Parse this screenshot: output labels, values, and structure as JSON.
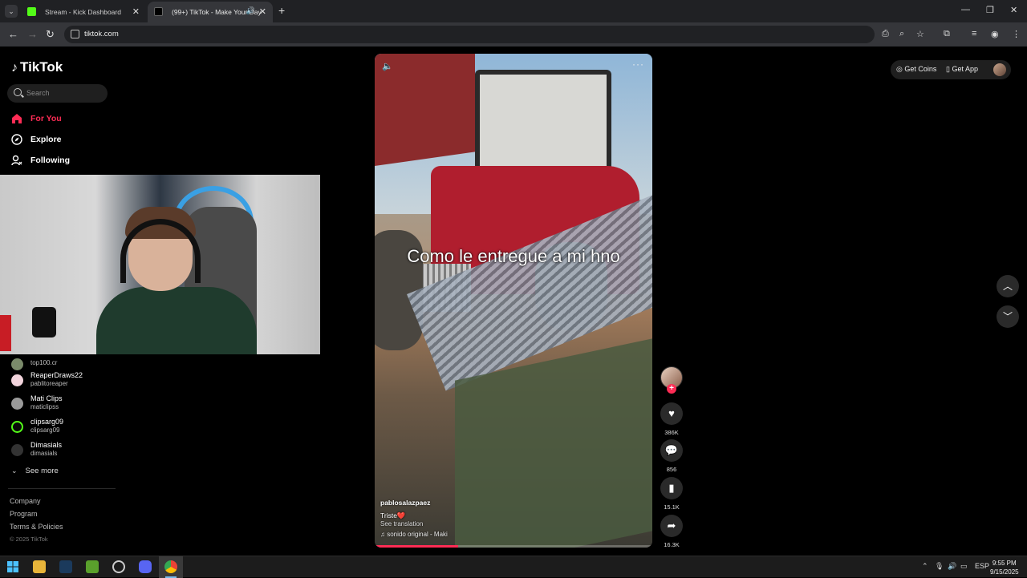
{
  "browser": {
    "tabs": [
      {
        "title": "Stream - Kick Dashboard"
      },
      {
        "title": "(99+) TikTok - Make Your Day"
      }
    ],
    "new_tab_label": "+",
    "url": "tiktok.com"
  },
  "tiktok": {
    "logo": "TikTok",
    "search_placeholder": "Search",
    "nav": [
      {
        "label": "For You"
      },
      {
        "label": "Explore"
      },
      {
        "label": "Following"
      }
    ],
    "following_accounts": [
      {
        "handle": "top100.cr"
      },
      {
        "name": "ReaperDraws22",
        "handle": "pablitoreaper"
      },
      {
        "name": "Mati Clips",
        "handle": "maticlipss"
      },
      {
        "name": "clipsarg09",
        "handle": "clipsarg09"
      },
      {
        "name": "Dimasials",
        "handle": "dimasials"
      }
    ],
    "see_more": "See more",
    "footer_links": [
      "Company",
      "Program",
      "Terms & Policies"
    ],
    "copyright": "© 2025 TikTok",
    "top_right": {
      "get_coins": "Get Coins",
      "get_app": "Get App"
    }
  },
  "video": {
    "caption": "Como le entregue a mi hno",
    "username": "pablosalazpaez",
    "description": "Triste❤️",
    "see_translation": "See translation",
    "sound": "sonido original - Maki",
    "progress": 0.3,
    "counts": {
      "likes": "386K",
      "comments": "856",
      "saves": "15.1K",
      "shares": "16.3K"
    }
  },
  "taskbar": {
    "language": "ESP",
    "time": "9:55 PM",
    "date": "9/15/2025"
  },
  "colors": {
    "accent": "#fe2c55",
    "background": "#000000"
  },
  "icons": [
    "tiktok-logo-icon",
    "search-icon",
    "home-icon",
    "compass-icon",
    "user-follow-icon",
    "speaker-icon",
    "heart-icon",
    "comment-icon",
    "bookmark-icon",
    "share-icon",
    "chevron-up-icon",
    "chevron-down-icon",
    "coin-icon",
    "phone-icon"
  ]
}
